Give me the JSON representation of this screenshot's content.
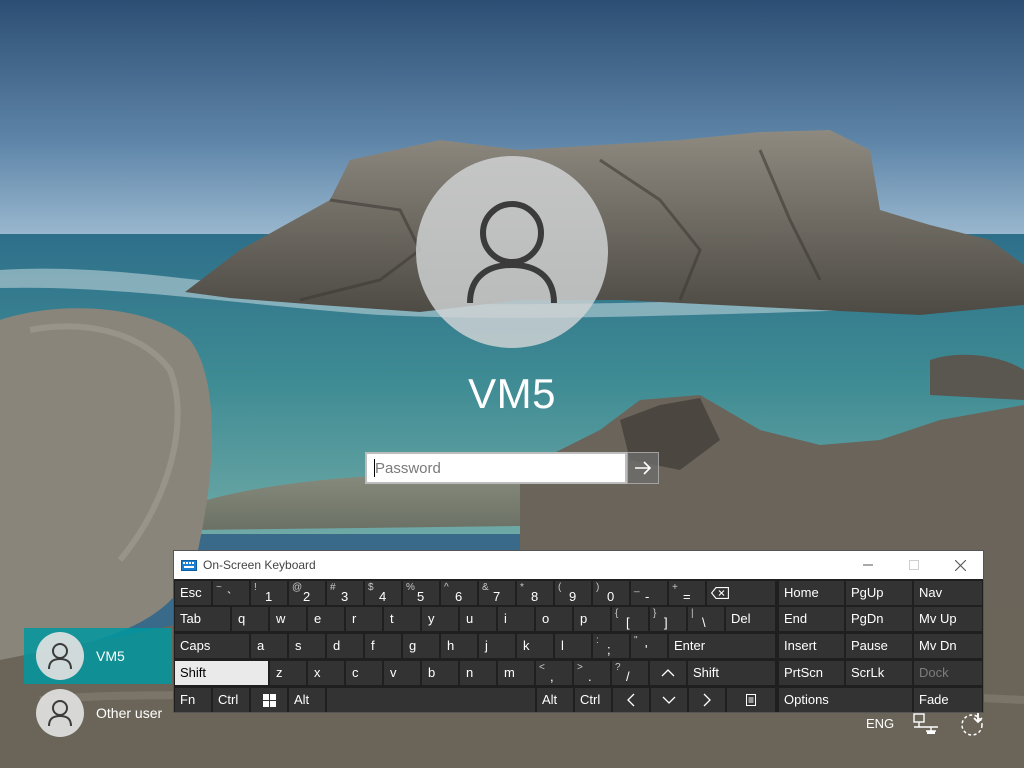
{
  "user": {
    "name": "VM5"
  },
  "password": {
    "placeholder": "Password",
    "value": ""
  },
  "osk": {
    "title": "On-Screen Keyboard",
    "rows": {
      "r1": [
        {
          "main": "Esc"
        },
        {
          "sub": "~",
          "main": "`"
        },
        {
          "sub": "!",
          "main": "1"
        },
        {
          "sub": "@",
          "main": "2"
        },
        {
          "sub": "#",
          "main": "3"
        },
        {
          "sub": "$",
          "main": "4"
        },
        {
          "sub": "%",
          "main": "5"
        },
        {
          "sub": "^",
          "main": "6"
        },
        {
          "sub": "&",
          "main": "7"
        },
        {
          "sub": "*",
          "main": "8"
        },
        {
          "sub": "(",
          "main": "9"
        },
        {
          "sub": ")",
          "main": "0"
        },
        {
          "sub": "_",
          "main": "-"
        },
        {
          "sub": "+",
          "main": "="
        }
      ],
      "r2": [
        "Tab",
        "q",
        "w",
        "e",
        "r",
        "t",
        "y",
        "u",
        "i",
        "o",
        "p"
      ],
      "r2sym": [
        {
          "sub": "{",
          "main": "["
        },
        {
          "sub": "}",
          "main": "]"
        },
        {
          "sub": "|",
          "main": "\\"
        }
      ],
      "r2end": "Del",
      "r3": [
        "Caps",
        "a",
        "s",
        "d",
        "f",
        "g",
        "h",
        "j",
        "k",
        "l"
      ],
      "r3sym": [
        {
          "sub": ":",
          "main": ";"
        },
        {
          "sub": "\"",
          "main": "'"
        }
      ],
      "r3end": "Enter",
      "r4": [
        "Shift",
        "z",
        "x",
        "c",
        "v",
        "b",
        "n",
        "m"
      ],
      "r4sym": [
        {
          "sub": "<",
          "main": ","
        },
        {
          "sub": ">",
          "main": "."
        },
        {
          "sub": "?",
          "main": "/"
        }
      ],
      "r4end": "Shift",
      "r5": [
        "Fn",
        "Ctrl",
        "Alt",
        "Alt",
        "Ctrl"
      ]
    },
    "nav": {
      "col1": [
        "Home",
        "End",
        "Insert",
        "PrtScn",
        "Options"
      ],
      "col2": [
        "PgUp",
        "PgDn",
        "Pause",
        "ScrLk"
      ],
      "col3": [
        "Nav",
        "Mv Up",
        "Mv Dn",
        "Dock",
        "Fade"
      ]
    }
  },
  "users": [
    {
      "name": "VM5",
      "selected": true
    },
    {
      "name": "Other user",
      "selected": false
    }
  ],
  "tray": {
    "language": "ENG"
  },
  "icons": [
    "user-avatar-icon",
    "arrow-right-icon",
    "keyboard-icon",
    "backspace-icon",
    "windows-icon",
    "menu-key-icon",
    "network-icon",
    "power-icon",
    "ease-of-access-icon"
  ]
}
